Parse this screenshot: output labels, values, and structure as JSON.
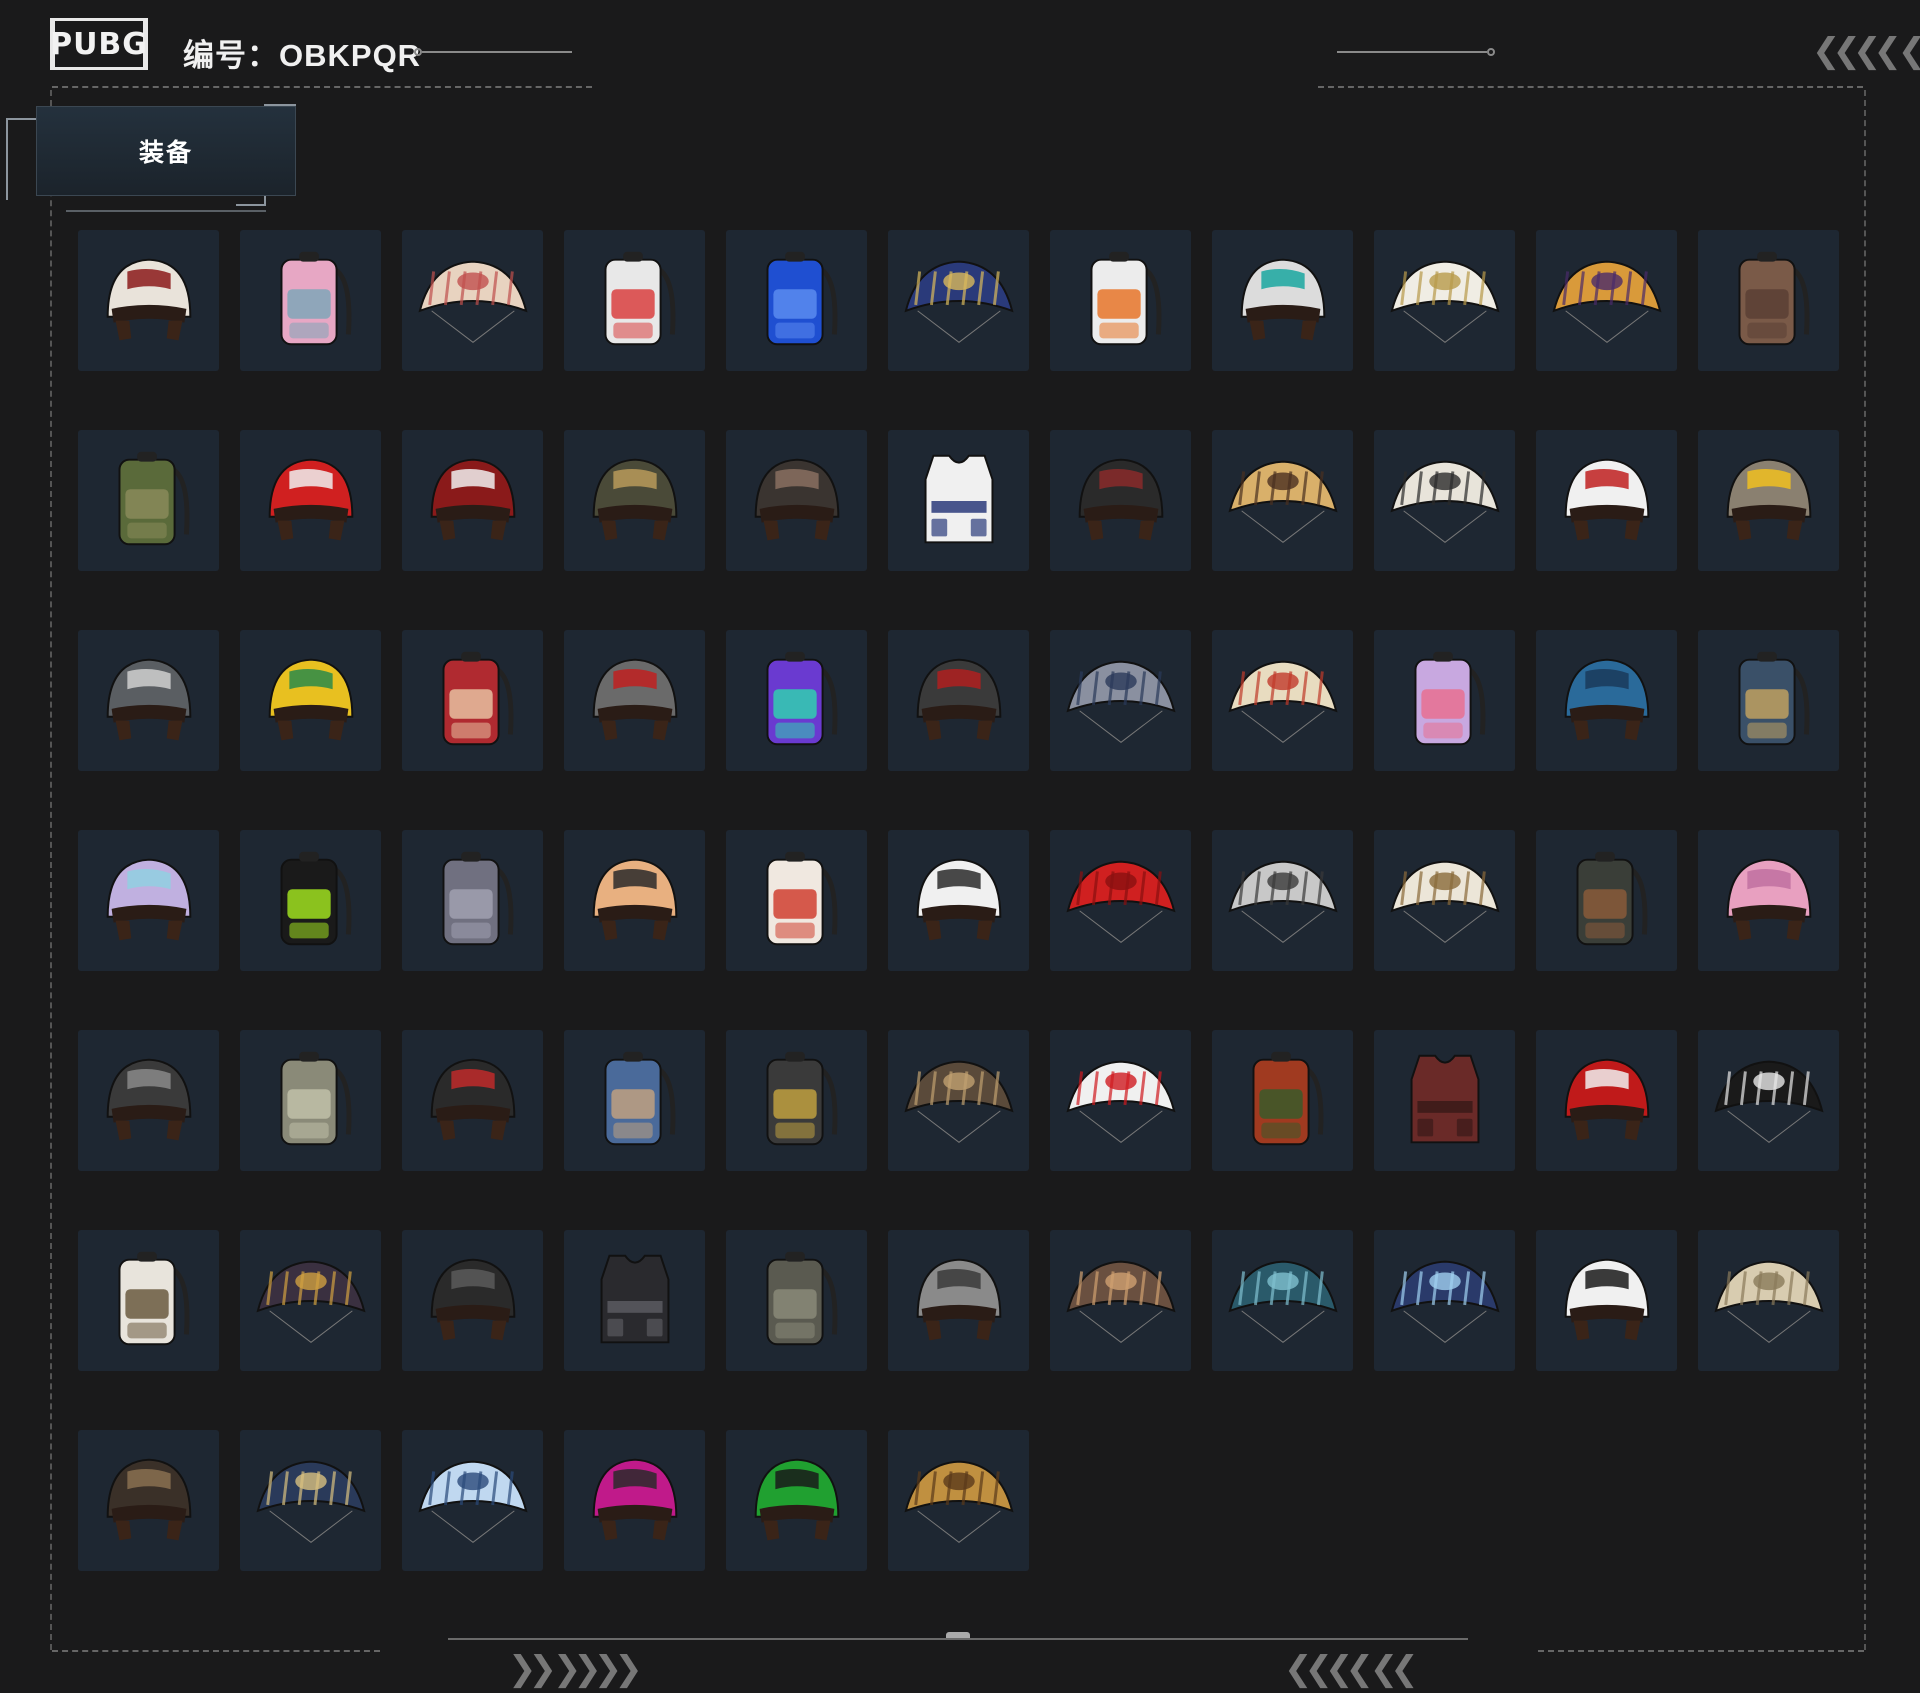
{
  "header": {
    "logo_text": "PUBG",
    "serial_label": "编号：OBKPQR"
  },
  "tabs": [
    {
      "label": "装备",
      "active": true
    }
  ],
  "colors": {
    "background": "#1a1a1b",
    "tile": "#1e2732",
    "accent_line": "#8a8a8a"
  },
  "decor": {
    "top_right_chevrons": "❮❮❮❮ ❮",
    "bottom_left_chevrons": "❯❯ ❯❯❯❯",
    "bottom_right_chevrons": "❮❮❮❮ ❮❮"
  },
  "items": [
    {
      "type": "helmet",
      "name": "helmet-checker-white",
      "c1": "#e9e3da",
      "c2": "#8b1a1a"
    },
    {
      "type": "backpack",
      "name": "backpack-pink",
      "c1": "#e7a7c4",
      "c2": "#7fa6b8"
    },
    {
      "type": "parachute",
      "name": "parachute-cream-red",
      "c1": "#e8d3c0",
      "c2": "#c0504d"
    },
    {
      "type": "backpack",
      "name": "backpack-colorful",
      "c1": "#e8e8e8",
      "c2": "#d94040"
    },
    {
      "type": "backpack",
      "name": "backpack-blue",
      "c1": "#1f4fd1",
      "c2": "#5b8bf0"
    },
    {
      "type": "parachute",
      "name": "parachute-blue-gold",
      "c1": "#2a3a7a",
      "c2": "#d9b95b"
    },
    {
      "type": "backpack",
      "name": "backpack-white-orange",
      "c1": "#ececec",
      "c2": "#e8762a"
    },
    {
      "type": "helmet",
      "name": "helmet-visor-teal",
      "c1": "#dcdcdc",
      "c2": "#1aa7a0"
    },
    {
      "type": "parachute",
      "name": "parachute-white-gold",
      "c1": "#f0ede4",
      "c2": "#b89a4a"
    },
    {
      "type": "parachute",
      "name": "parachute-gold-purple",
      "c1": "#d99a3a",
      "c2": "#4a2a6a"
    },
    {
      "type": "backpack",
      "name": "backpack-brown",
      "c1": "#7a5a48",
      "c2": "#5a4035"
    },
    {
      "type": "backpack",
      "name": "backpack-camo-green",
      "c1": "#5a6a3a",
      "c2": "#8a8a5a"
    },
    {
      "type": "helmet",
      "name": "helmet-jester",
      "c1": "#d02020",
      "c2": "#f0f0f0"
    },
    {
      "type": "helmet",
      "name": "helmet-red-dots",
      "c1": "#8a1a1a",
      "c2": "#f0f0f0"
    },
    {
      "type": "helmet",
      "name": "helmet-olive-gold",
      "c1": "#4a4a38",
      "c2": "#b89a5a"
    },
    {
      "type": "helmet",
      "name": "helmet-spartan",
      "c1": "#3a3430",
      "c2": "#8a7060"
    },
    {
      "type": "vest",
      "name": "vest-sailor",
      "c1": "#f0f0f0",
      "c2": "#2a3a7a"
    },
    {
      "type": "helmet",
      "name": "helmet-black-red",
      "c1": "#2a2a2a",
      "c2": "#8a2a2a"
    },
    {
      "type": "parachute",
      "name": "parachute-gold-wings",
      "c1": "#d9b06a",
      "c2": "#4a3020"
    },
    {
      "type": "parachute",
      "name": "parachute-white-black",
      "c1": "#e8e4da",
      "c2": "#2a2a2a"
    },
    {
      "type": "helmet",
      "name": "helmet-dalmatian",
      "c1": "#f0f0f0",
      "c2": "#c02020"
    },
    {
      "type": "helmet",
      "name": "helmet-star",
      "c1": "#8a8070",
      "c2": "#f0c020"
    },
    {
      "type": "helmet",
      "name": "helmet-grey-horns",
      "c1": "#5a5e62",
      "c2": "#d0d0d0"
    },
    {
      "type": "helmet",
      "name": "helmet-racer-yellow",
      "c1": "#e8c020",
      "c2": "#2a8a4a"
    },
    {
      "type": "backpack",
      "name": "backpack-red-waves",
      "c1": "#b02a30",
      "c2": "#e8c0a0"
    },
    {
      "type": "helmet",
      "name": "helmet-knight",
      "c1": "#6a6a6a",
      "c2": "#c02020"
    },
    {
      "type": "backpack",
      "name": "backpack-purple-teal",
      "c1": "#6a3ad0",
      "c2": "#30d0b0"
    },
    {
      "type": "helmet",
      "name": "helmet-dark-red",
      "c1": "#3a3a3a",
      "c2": "#b02020"
    },
    {
      "type": "parachute",
      "name": "parachute-grey-blue",
      "c1": "#8a90a0",
      "c2": "#2a3a5a"
    },
    {
      "type": "parachute",
      "name": "parachute-tattoo",
      "c1": "#e8dcc0",
      "c2": "#c03a2a"
    },
    {
      "type": "backpack",
      "name": "backpack-lavender",
      "c1": "#c8a8e0",
      "c2": "#e87090"
    },
    {
      "type": "helmet",
      "name": "helmet-blue-samurai",
      "c1": "#2a6a9a",
      "c2": "#1a3a5a"
    },
    {
      "type": "backpack",
      "name": "backpack-slate-blue",
      "c1": "#3a5068",
      "c2": "#c0a060"
    },
    {
      "type": "helmet",
      "name": "helmet-pastel",
      "c1": "#c0b0e0",
      "c2": "#90d0e0"
    },
    {
      "type": "backpack",
      "name": "backpack-black-lime",
      "c1": "#1a1a1a",
      "c2": "#a0e020"
    },
    {
      "type": "backpack",
      "name": "backpack-grey-pattern",
      "c1": "#707080",
      "c2": "#a0a0b0"
    },
    {
      "type": "helmet",
      "name": "helmet-floral-visor",
      "c1": "#e8b080",
      "c2": "#2a2a2a"
    },
    {
      "type": "backpack",
      "name": "backpack-white-red",
      "c1": "#f0e8e0",
      "c2": "#d04030"
    },
    {
      "type": "helmet",
      "name": "helmet-white-greek",
      "c1": "#f0f0f0",
      "c2": "#2a2a2a"
    },
    {
      "type": "parachute",
      "name": "parachute-red",
      "c1": "#d02020",
      "c2": "#8a1010"
    },
    {
      "type": "parachute",
      "name": "parachute-leopard",
      "c1": "#c8c8c8",
      "c2": "#3a3a3a"
    },
    {
      "type": "parachute",
      "name": "parachute-cream-gold",
      "c1": "#ece6d8",
      "c2": "#8a6a3a"
    },
    {
      "type": "backpack",
      "name": "backpack-dark-green",
      "c1": "#3a3e38",
      "c2": "#8a5a3a"
    },
    {
      "type": "helmet",
      "name": "helmet-pink-bunny",
      "c1": "#e8a0c0",
      "c2": "#c070a0"
    },
    {
      "type": "helmet",
      "name": "helmet-black-glossy",
      "c1": "#3a3a3a",
      "c2": "#8a8a8a"
    },
    {
      "type": "backpack",
      "name": "backpack-khaki",
      "c1": "#8a8a78",
      "c2": "#c0c0a8"
    },
    {
      "type": "helmet",
      "name": "helmet-black-stripe",
      "c1": "#2a2a2a",
      "c2": "#c02a2a"
    },
    {
      "type": "backpack",
      "name": "backpack-denim",
      "c1": "#4a6a9a",
      "c2": "#c0a080"
    },
    {
      "type": "backpack",
      "name": "backpack-patches",
      "c1": "#3a3a3a",
      "c2": "#c0a040"
    },
    {
      "type": "parachute",
      "name": "parachute-dark-bronze",
      "c1": "#5a4a3a",
      "c2": "#c0a070"
    },
    {
      "type": "parachute",
      "name": "parachute-kfc",
      "c1": "#f0f0f0",
      "c2": "#d01a20"
    },
    {
      "type": "backpack",
      "name": "backpack-plaid-red",
      "c1": "#a03a20",
      "c2": "#3a5a2a"
    },
    {
      "type": "vest",
      "name": "vest-maroon",
      "c1": "#6a2a28",
      "c2": "#3a1a18"
    },
    {
      "type": "helmet",
      "name": "helmet-santa",
      "c1": "#c01a1a",
      "c2": "#f0f0f0"
    },
    {
      "type": "parachute",
      "name": "parachute-black-white-geo",
      "c1": "#1a1a1a",
      "c2": "#e8e8e8"
    },
    {
      "type": "backpack",
      "name": "backpack-white-fringe",
      "c1": "#e8e4dc",
      "c2": "#6a5a40"
    },
    {
      "type": "parachute",
      "name": "parachute-23",
      "c1": "#3a3040",
      "c2": "#d0a040"
    },
    {
      "type": "helmet",
      "name": "helmet-black-plain",
      "c1": "#2a2a2a",
      "c2": "#5a5a5a"
    },
    {
      "type": "vest",
      "name": "vest-black",
      "c1": "#2a2a2e",
      "c2": "#5a5a60"
    },
    {
      "type": "backpack",
      "name": "backpack-olive-grey",
      "c1": "#5a5a50",
      "c2": "#8a8a78"
    },
    {
      "type": "helmet",
      "name": "helmet-moto-silver",
      "c1": "#8a8a8a",
      "c2": "#3a3a3a"
    },
    {
      "type": "parachute",
      "name": "parachute-bronze-wings",
      "c1": "#6a5040",
      "c2": "#d0a070"
    },
    {
      "type": "parachute",
      "name": "parachute-teal",
      "c1": "#2a5a6a",
      "c2": "#80c0d0"
    },
    {
      "type": "parachute",
      "name": "parachute-blue-lightning",
      "c1": "#2a3a6a",
      "c2": "#a0d0f0"
    },
    {
      "type": "helmet",
      "name": "helmet-white-swirl",
      "c1": "#f0f0f0",
      "c2": "#1a1a1a"
    },
    {
      "type": "parachute",
      "name": "parachute-beige",
      "c1": "#d8ccb0",
      "c2": "#8a7a5a"
    },
    {
      "type": "helmet",
      "name": "helmet-monogram",
      "c1": "#3a3028",
      "c2": "#8a7050"
    },
    {
      "type": "parachute",
      "name": "parachute-navy-gold",
      "c1": "#2a3a5a",
      "c2": "#d8c080"
    },
    {
      "type": "parachute",
      "name": "parachute-ice-blue",
      "c1": "#c0d8f0",
      "c2": "#2a4a7a"
    },
    {
      "type": "helmet",
      "name": "helmet-moto-magenta",
      "c1": "#c01a8a",
      "c2": "#2a2a2a"
    },
    {
      "type": "helmet",
      "name": "helmet-moto-green",
      "c1": "#20a030",
      "c2": "#1a1a1a"
    },
    {
      "type": "parachute",
      "name": "parachute-gold-brown",
      "c1": "#c09040",
      "c2": "#5a3a1a"
    }
  ]
}
